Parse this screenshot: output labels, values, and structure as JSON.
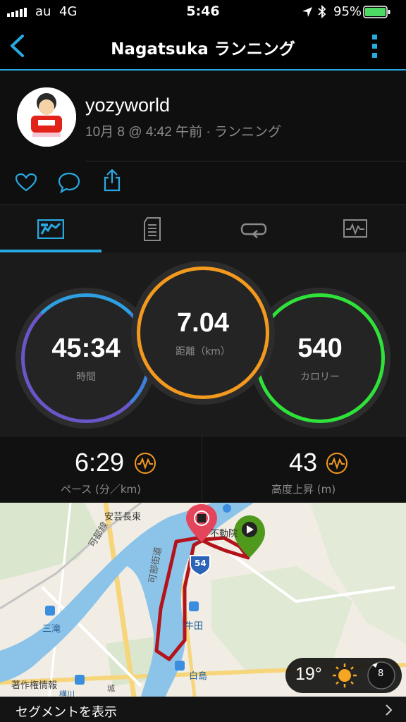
{
  "status_bar": {
    "carrier": "au",
    "network": "4G",
    "time": "5:46",
    "battery": "95%"
  },
  "nav": {
    "title": "Nagatsuka ランニング"
  },
  "profile": {
    "username": "yozyworld",
    "subtitle": "10月 8 @ 4:42 午前 · ランニング"
  },
  "stats": {
    "time": {
      "value": "45:34",
      "label": "時間"
    },
    "distance": {
      "value": "7.04",
      "label": "距離（km）"
    },
    "calories": {
      "value": "540",
      "label": "カロリー"
    },
    "pace": {
      "value": "6:29",
      "label": "ペース (分／km)"
    },
    "elevation": {
      "value": "43",
      "label": "高度上昇 (m)"
    }
  },
  "map": {
    "labels": {
      "aki": "安芸長束",
      "kabe_line": "可部線",
      "kabe_road": "可部街道",
      "fudoin": "不動院",
      "route": "54",
      "ushita": "牛田",
      "mitaki": "三滝",
      "hakushima": "白島",
      "copyright": "著作権情報",
      "yokogawa": "横川",
      "shiro": "城"
    },
    "weather": {
      "temp": "19°",
      "wind": "8"
    }
  },
  "segment": {
    "label": "セグメントを表示"
  },
  "colors": {
    "accent": "#29a9e1",
    "time_ring": "#6a56c8",
    "distance_ring": "#f39a1e",
    "calories_ring": "#2fe23a",
    "route": "#b3141c"
  }
}
